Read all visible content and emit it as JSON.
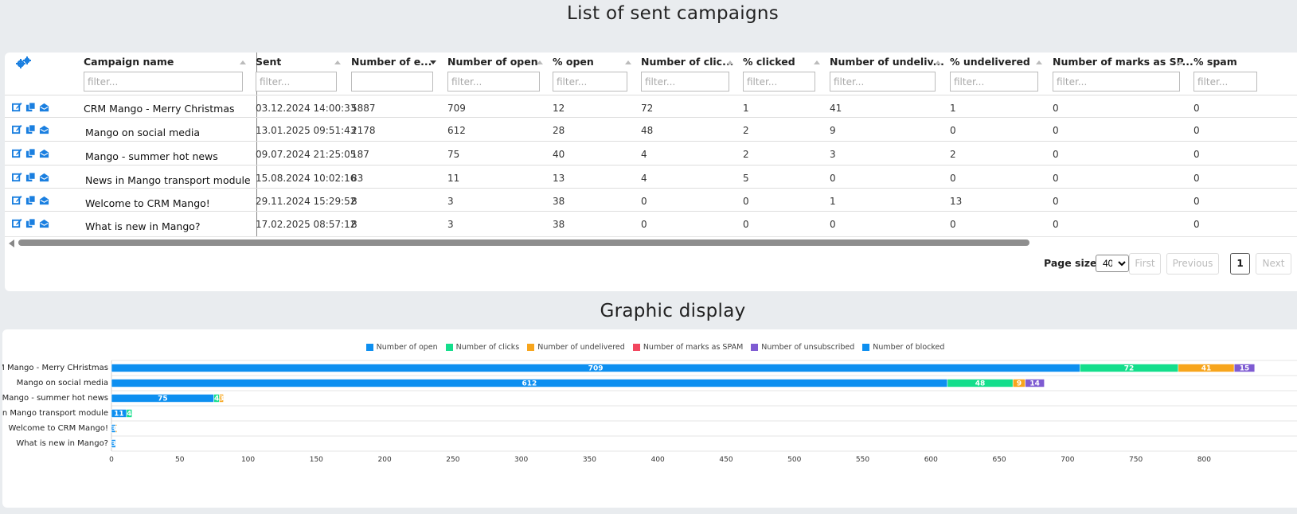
{
  "page": {
    "title": "List of sent campaigns",
    "chart_title": "Graphic display"
  },
  "grid": {
    "settings_icon": "gears-icon",
    "filter_placeholder": "filter...",
    "columns": [
      {
        "label": "Campaign name",
        "sort": "none"
      },
      {
        "label": "Sent",
        "sort": "none"
      },
      {
        "label": "Number of e...",
        "sort": "desc"
      },
      {
        "label": "Number of open",
        "sort": "none"
      },
      {
        "label": "% open",
        "sort": "none"
      },
      {
        "label": "Number of clic...",
        "sort": "none"
      },
      {
        "label": "% clicked",
        "sort": "none"
      },
      {
        "label": "Number of undeliv...",
        "sort": "none"
      },
      {
        "label": "% undelivered",
        "sort": "none"
      },
      {
        "label": "Number of marks as SP...",
        "sort": "none"
      },
      {
        "label": "% spam",
        "sort": "none"
      }
    ],
    "row_actions": [
      "edit-icon",
      "copy-icon",
      "mail-icon"
    ],
    "rows": [
      {
        "name": "CRM Mango - Merry Christmas",
        "sent": "03.12.2024 14:00:33",
        "emails": "5887",
        "open": "709",
        "pct_open": "12",
        "clicks": "72",
        "pct_clicked": "1",
        "undelivered": "41",
        "pct_undelivered": "1",
        "spam_marks": "0",
        "pct_spam": "0"
      },
      {
        "name": "Mango on social media",
        "sent": "13.01.2025 09:51:43",
        "emails": "2178",
        "open": "612",
        "pct_open": "28",
        "clicks": "48",
        "pct_clicked": "2",
        "undelivered": "9",
        "pct_undelivered": "0",
        "spam_marks": "0",
        "pct_spam": "0"
      },
      {
        "name": "Mango - summer hot news",
        "sent": "09.07.2024 21:25:05",
        "emails": "187",
        "open": "75",
        "pct_open": "40",
        "clicks": "4",
        "pct_clicked": "2",
        "undelivered": "3",
        "pct_undelivered": "2",
        "spam_marks": "0",
        "pct_spam": "0"
      },
      {
        "name": "News in Mango transport module",
        "sent": "15.08.2024 10:02:16",
        "emails": "83",
        "open": "11",
        "pct_open": "13",
        "clicks": "4",
        "pct_clicked": "5",
        "undelivered": "0",
        "pct_undelivered": "0",
        "spam_marks": "0",
        "pct_spam": "0"
      },
      {
        "name": "Welcome to CRM Mango!",
        "sent": "29.11.2024 15:29:52",
        "emails": "8",
        "open": "3",
        "pct_open": "38",
        "clicks": "0",
        "pct_clicked": "0",
        "undelivered": "1",
        "pct_undelivered": "13",
        "spam_marks": "0",
        "pct_spam": "0"
      },
      {
        "name": "What is new in Mango?",
        "sent": "17.02.2025 08:57:12",
        "emails": "8",
        "open": "3",
        "pct_open": "38",
        "clicks": "0",
        "pct_clicked": "0",
        "undelivered": "0",
        "pct_undelivered": "0",
        "spam_marks": "0",
        "pct_spam": "0"
      }
    ]
  },
  "pager": {
    "page_size_label": "Page size",
    "page_size_value": "40",
    "first": "First",
    "previous": "Previous",
    "current": "1",
    "next": "Next"
  },
  "colors": {
    "accent": "#1a7fe0",
    "open": "#0d8ff0",
    "clicks": "#14de8c",
    "undelivered": "#f7a51c",
    "spam": "#f2465e",
    "unsubscribed": "#7e5bd2",
    "blocked": "#0d8ff0"
  },
  "chart_data": {
    "type": "bar",
    "orientation": "horizontal",
    "stacked": true,
    "title": "",
    "xlabel": "",
    "ylabel": "",
    "xlim": [
      0,
      830
    ],
    "xticks": [
      0,
      50,
      100,
      150,
      200,
      250,
      300,
      350,
      400,
      450,
      500,
      550,
      600,
      650,
      700,
      750,
      800
    ],
    "legend_position": "top",
    "categories": [
      "CRM Mango - Merry CHristmas",
      "Mango on social media",
      "Mango - summer hot news",
      "News in Mango transport module",
      "Welcome to CRM Mango!",
      "What is new in Mango?"
    ],
    "series": [
      {
        "name": "Number of open",
        "color": "#0d8ff0",
        "values": [
          709,
          612,
          75,
          11,
          3,
          3
        ]
      },
      {
        "name": "Number of clicks",
        "color": "#14de8c",
        "values": [
          72,
          48,
          4,
          4,
          0,
          0
        ]
      },
      {
        "name": "Number of undelivered",
        "color": "#f7a51c",
        "values": [
          41,
          9,
          3,
          0,
          1,
          0
        ]
      },
      {
        "name": "Number of marks as SPAM",
        "color": "#f2465e",
        "values": [
          0,
          0,
          0,
          0,
          0,
          0
        ]
      },
      {
        "name": "Number of unsubscribed",
        "color": "#7e5bd2",
        "values": [
          15,
          14,
          0,
          0,
          0,
          0
        ]
      },
      {
        "name": "Number of blocked",
        "color": "#0d8ff0",
        "values": [
          0,
          0,
          0,
          0,
          0,
          0
        ]
      }
    ]
  }
}
